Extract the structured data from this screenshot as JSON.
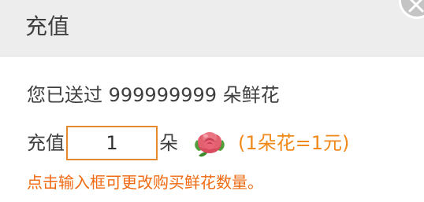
{
  "header": {
    "title": "充值"
  },
  "summary": {
    "sent_text": "您已送过 999999999 朵鲜花"
  },
  "recharge": {
    "prefix_label": "充值",
    "quantity_value": "1",
    "unit_label": "朵",
    "flower_icon": "rose-icon",
    "price_note": "(1朵花=1元)"
  },
  "hint": "点击输入框可更改购买鲜花数量。",
  "colors": {
    "accent": "#e38a2f",
    "price": "#ef8a1a",
    "hint": "#ef6a12",
    "header_bg": "#ededed"
  }
}
